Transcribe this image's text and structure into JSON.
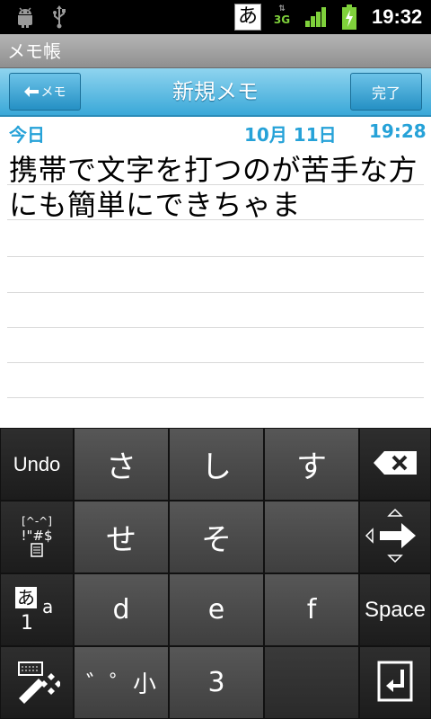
{
  "status_bar": {
    "ime_indicator": "あ",
    "network": "3G",
    "time": "19:32",
    "icons": [
      "android-debug-icon",
      "usb-icon",
      "ime-icon",
      "data-3g-icon",
      "signal-icon",
      "battery-charging-icon"
    ]
  },
  "app_bar": {
    "title": "メモ帳"
  },
  "header": {
    "back_label": "メモ",
    "title": "新規メモ",
    "done_label": "完了"
  },
  "note": {
    "day": "今日",
    "date": "10月 11日",
    "time": "19:28",
    "text": "携帯で文字を打つのが苦手な方にも簡単にできちゃま"
  },
  "keyboard": {
    "undo": "Undo",
    "row1": [
      "さ",
      "し",
      "す"
    ],
    "row2": [
      "せ",
      "そ",
      ""
    ],
    "row3": [
      "d",
      "e",
      "f"
    ],
    "row4_dakuten": "゛゜小",
    "row4_num": "3",
    "symbols_line1": "[^-^]",
    "symbols_line2": "!\"#$",
    "mode_kana": "あ",
    "mode_num": "1",
    "mode_alpha": "a",
    "space": "Space"
  },
  "colors": {
    "accent": "#26a2d8",
    "header_top": "#8fd4ef",
    "header_bottom": "#3aa8d8",
    "keyboard_bg": "#212121"
  }
}
